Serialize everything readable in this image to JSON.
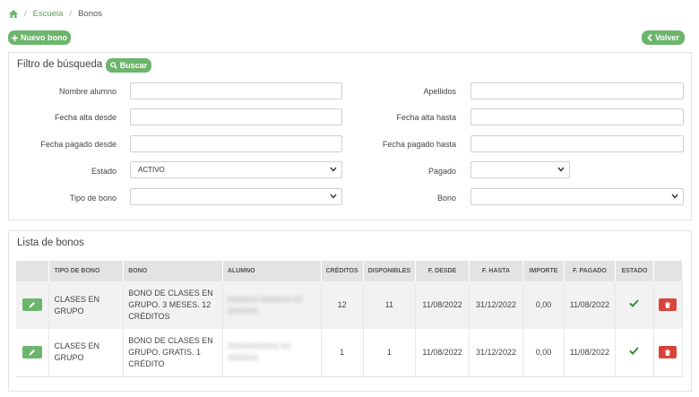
{
  "breadcrumb": {
    "items": [
      "Escuela",
      "Bonos"
    ]
  },
  "toolbar": {
    "new_label": "Nuevo bono",
    "back_label": "Volver"
  },
  "filter": {
    "title": "Filtro de búsqueda",
    "search_label": "Buscar",
    "fields": {
      "nombre": {
        "label": "Nombre alumno",
        "value": ""
      },
      "apellidos": {
        "label": "Apellidos",
        "value": ""
      },
      "fecha_alta_desde": {
        "label": "Fecha alta desde",
        "value": ""
      },
      "fecha_alta_hasta": {
        "label": "Fecha alta hasta",
        "value": ""
      },
      "fecha_pagado_desde": {
        "label": "Fecha pagado desde",
        "value": ""
      },
      "fecha_pagado_hasta": {
        "label": "Fecha pagado hasta",
        "value": ""
      },
      "estado": {
        "label": "Estado",
        "value": "ACTIVO"
      },
      "pagado": {
        "label": "Pagado",
        "value": ""
      },
      "tipo_bono": {
        "label": "Tipo de bono",
        "value": ""
      },
      "bono": {
        "label": "Bono",
        "value": ""
      }
    }
  },
  "list": {
    "title": "Lista de bonos",
    "columns": [
      "TIPO DE BONO",
      "BONO",
      "ALUMNO",
      "CRÉDITOS",
      "DISPONIBLES",
      "F. DESDE",
      "F. HASTA",
      "IMPORTE",
      "F. PAGADO",
      "ESTADO"
    ],
    "rows": [
      {
        "tipo": "CLASES EN GRUPO",
        "bono": "BONO DE CLASES EN GRUPO. 3 MESES. 12 CRÉDITOS",
        "alumno": "XXXXXX XXXXXX XX XXXXXX",
        "creditos": "12",
        "disponibles": "11",
        "desde": "11/08/2022",
        "hasta": "31/12/2022",
        "importe": "0,00",
        "pagado": "11/08/2022"
      },
      {
        "tipo": "CLASES EN GRUPO",
        "bono": "BONO DE CLASES EN GRUPO. GRATIS. 1 CRÉDITO",
        "alumno": "XXXXXXXXXX XX XXXXXX",
        "creditos": "1",
        "disponibles": "1",
        "desde": "11/08/2022",
        "hasta": "31/12/2022",
        "importe": "0,00",
        "pagado": "11/08/2022"
      }
    ]
  },
  "colors": {
    "accent": "#6cb56c",
    "danger": "#d9443a",
    "check": "#3a8a3a"
  }
}
